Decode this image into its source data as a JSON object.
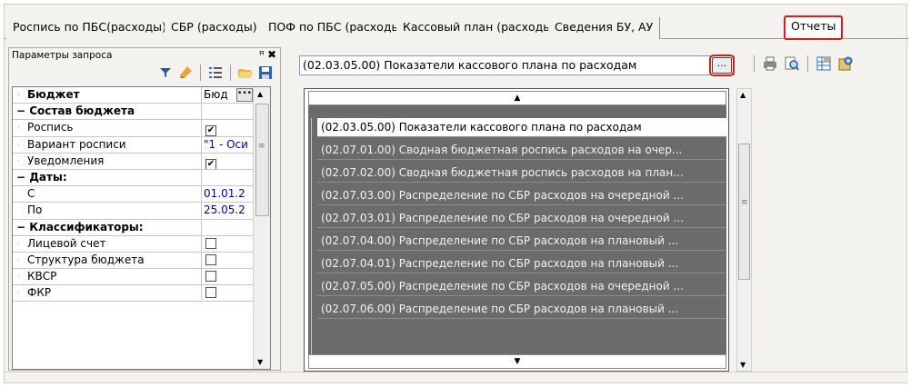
{
  "tabs": [
    "Роспись по ПБС(расходы)",
    "СБР (расходы)",
    "ПОФ по ПБС (расходы)",
    "Кассовый план (расходы)",
    "Сведения БУ, АУ",
    "Отчеты"
  ],
  "params": {
    "title": "Параметры запроса",
    "pin_glyph": "ꟸ",
    "close_glyph": "✖",
    "rows": [
      {
        "label": "Бюджет",
        "value": "Бюд",
        "kind": "prop-ellipsis"
      },
      {
        "label": "− Состав бюджета",
        "kind": "group"
      },
      {
        "label": "Роспись",
        "value": "✔",
        "kind": "check"
      },
      {
        "label": "Вариант росписи",
        "value": "\"1 - Оси",
        "kind": "text"
      },
      {
        "label": "Уведомления",
        "value": "✔",
        "kind": "check"
      },
      {
        "label": "− Даты:",
        "kind": "group"
      },
      {
        "label": "С",
        "value": "01.01.2",
        "kind": "date"
      },
      {
        "label": "По",
        "value": "25.05.2",
        "kind": "date"
      },
      {
        "label": "− Классификаторы:",
        "kind": "group"
      },
      {
        "label": "Лицевой счет",
        "value": "",
        "kind": "check"
      },
      {
        "label": "Структура бюджета",
        "value": "",
        "kind": "check"
      },
      {
        "label": "КВСР",
        "value": "",
        "kind": "check"
      },
      {
        "label": "ФКР",
        "value": "",
        "kind": "check"
      }
    ]
  },
  "report_combo": {
    "value": "(02.03.05.00) Показатели кассового плана по расходам",
    "button": "..."
  },
  "report_list": [
    "(02.03.05.00) Показатели кассового плана по расходам",
    "(02.07.01.00) Сводная бюджетная роспись расходов на очер...",
    "(02.07.02.00) Сводная бюджетная роспись расходов на план...",
    "(02.07.03.00) Распределение по СБР расходов на очередной ...",
    "(02.07.03.01) Распределение по СБР расходов на очередной ...",
    "(02.07.04.00) Распределение по СБР расходов на плановый ...",
    "(02.07.04.01) Распределение по СБР расходов на плановый ...",
    "(02.07.05.00) Распределение по СБР расходов на очередной ...",
    "(02.07.06.00) Распределение по СБР расходов на плановый ..."
  ]
}
